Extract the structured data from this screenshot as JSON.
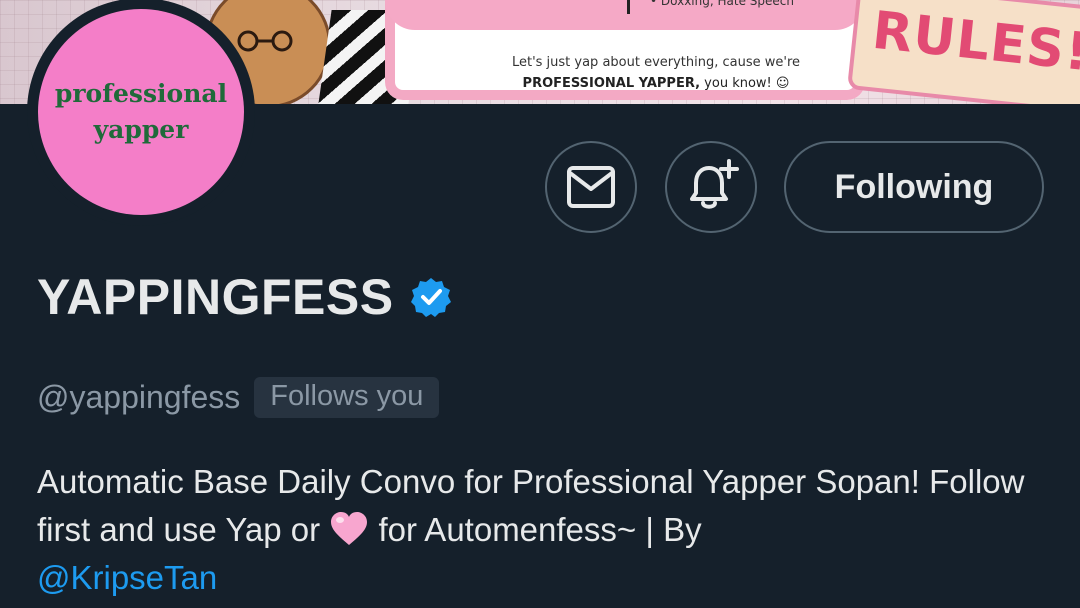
{
  "banner": {
    "card_top_text": "• Doxxing, Hate Speech",
    "card_line1": "Let's just yap about everything, cause we're",
    "card_line2_bold": "PROFESSIONAL YAPPER,",
    "card_line2_rest": " you know! ☺",
    "rules_label": "RULES!"
  },
  "avatar": {
    "line1": "professional",
    "line2": "yapper",
    "color": "#f47ec8"
  },
  "actions": {
    "message_icon": "mail-icon",
    "notify_icon": "bell-plus-icon",
    "following_label": "Following"
  },
  "profile": {
    "display_name": "YAPPINGFESS",
    "verified_icon": "verified-badge-icon",
    "verified_color": "#1d9bf0",
    "handle": "@yappingfess",
    "follows_you": "Follows you",
    "bio_part1": "Automatic Base Daily Convo for Professional Yapper Sopan! Follow first and use Yap or ",
    "bio_emoji": "pink-heart-icon",
    "bio_part2": " for Automenfess~ | By",
    "bio_mention": "@KripseTan"
  }
}
